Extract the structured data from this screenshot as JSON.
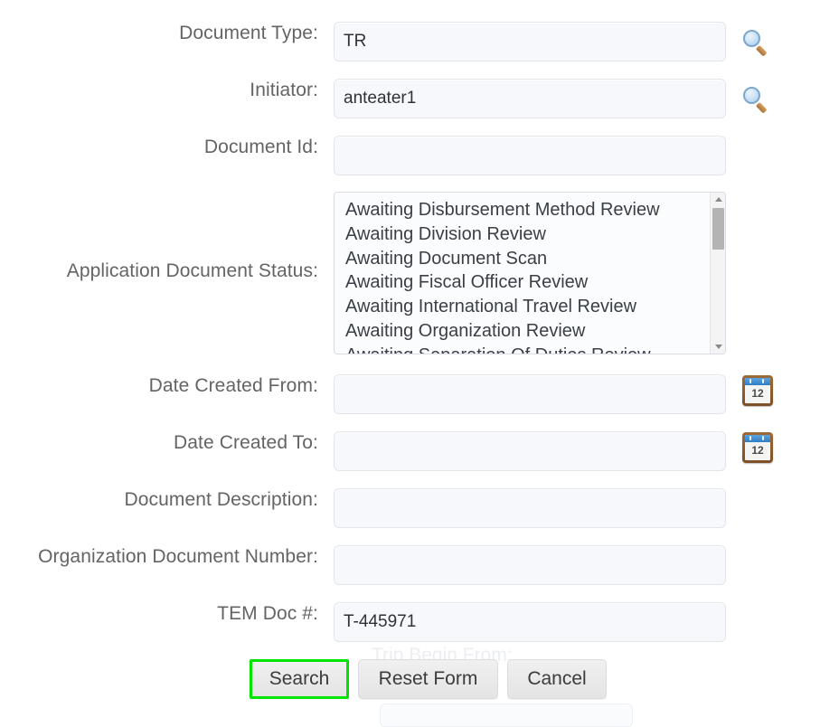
{
  "form": {
    "fields": [
      {
        "label": "Document Type:",
        "value": "TR",
        "placeholder": "",
        "icon": "magnifier-icon"
      },
      {
        "label": "Initiator:",
        "value": "anteater1",
        "placeholder": "",
        "icon": "magnifier-icon"
      },
      {
        "label": "Document Id:",
        "value": "",
        "placeholder": "",
        "icon": "none"
      },
      {
        "label": "Date Created From:",
        "value": "",
        "placeholder": "",
        "icon": "calendar-icon"
      },
      {
        "label": "Date Created To:",
        "value": "",
        "placeholder": "",
        "icon": "calendar-icon"
      },
      {
        "label": "Document Description:",
        "value": "",
        "placeholder": "",
        "icon": "none"
      },
      {
        "label": "Organization Document Number:",
        "value": "",
        "placeholder": "",
        "icon": "none"
      },
      {
        "label": "TEM Doc #:",
        "value": "T-445971",
        "placeholder": "",
        "icon": "none"
      }
    ],
    "status_list": {
      "label": "Application Document Status:",
      "options": [
        "Awaiting Disbursement Method Review",
        "Awaiting Division Review",
        "Awaiting Document Scan",
        "Awaiting Fiscal Officer Review",
        "Awaiting International Travel Review",
        "Awaiting Organization Review",
        "Awaiting Separation Of Duties Review"
      ],
      "selected": []
    },
    "obscured_label": "Trip Begin From:"
  },
  "buttons": {
    "search": "Search",
    "reset": "Reset Form",
    "cancel": "Cancel"
  },
  "icons": {
    "calendar_day": "12"
  },
  "colors": {
    "highlight": "#00e400",
    "label_text": "#646464",
    "input_bg": "#f6f8fb",
    "input_border": "#e2e5ea",
    "button_bg": "#e9e9e9"
  }
}
